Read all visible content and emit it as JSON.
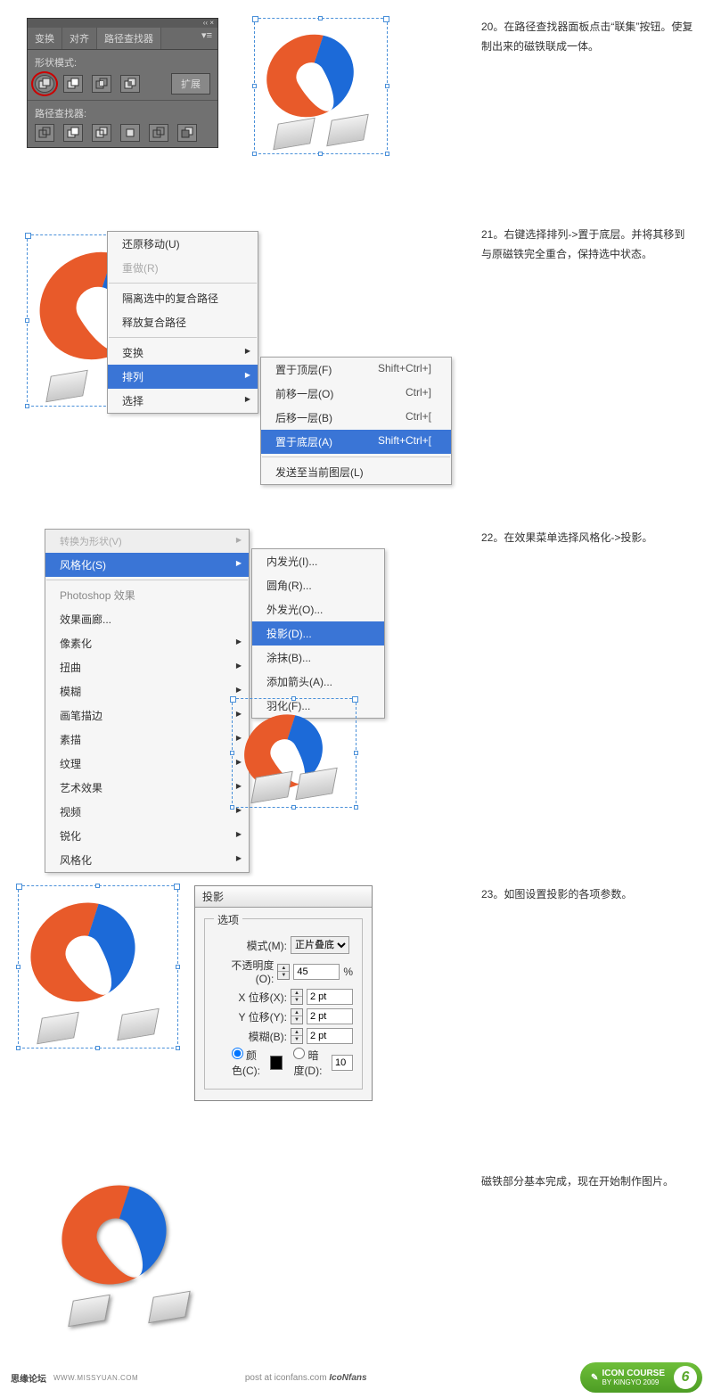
{
  "steps": {
    "s20": "20。在路径查找器面板点击“联集”按钮。使复制出来的磁铁联成一体。",
    "s21": "21。右键选择排列->置于底层。并将其移到与原磁铁完全重合，保持选中状态。",
    "s22": "22。在效果菜单选择风格化->投影。",
    "s23": "23。如图设置投影的各项参数。",
    "final": "磁铁部分基本完成，现在开始制作图片。"
  },
  "pathfinder": {
    "tabs": [
      "变换",
      "对齐",
      "路径查找器"
    ],
    "menuGlyph": "▾≡",
    "shape_label": "形状模式:",
    "path_label": "路径查找器:",
    "expand": "扩展",
    "titlebar": "‹‹ ×"
  },
  "ctxmenu1": {
    "items": [
      {
        "label": "还原移动(U)"
      },
      {
        "label": "重做(R)",
        "disabled": true
      },
      {
        "sep": true
      },
      {
        "label": "隔离选中的复合路径"
      },
      {
        "label": "释放复合路径"
      },
      {
        "sep": true
      },
      {
        "label": "变换",
        "sub": true
      },
      {
        "label": "排列",
        "sub": true,
        "hl": true
      },
      {
        "label": "选择",
        "sub": true
      }
    ],
    "submenu": [
      {
        "label": "置于顶层(F)",
        "shortcut": "Shift+Ctrl+]"
      },
      {
        "label": "前移一层(O)",
        "shortcut": "Ctrl+]"
      },
      {
        "label": "后移一层(B)",
        "shortcut": "Ctrl+["
      },
      {
        "label": "置于底层(A)",
        "shortcut": "Shift+Ctrl+[",
        "hl": true
      },
      {
        "sep": true
      },
      {
        "label": "发送至当前图层(L)"
      }
    ]
  },
  "fxmenu": {
    "top_cut": "转换为形状(V)",
    "stylize": "风格化(S)",
    "ps_header": "Photoshop 效果",
    "groups": [
      "效果画廊...",
      "像素化",
      "扭曲",
      "模糊",
      "画笔描边",
      "素描",
      "纹理",
      "艺术效果",
      "视频",
      "锐化",
      "风格化"
    ],
    "submenu": [
      "内发光(I)...",
      "圆角(R)...",
      "外发光(O)...",
      "投影(D)...",
      "涂抹(B)...",
      "添加箭头(A)...",
      "羽化(F)..."
    ],
    "hl_sub": "投影(D)..."
  },
  "dialog": {
    "title": "投影",
    "options_label": "选项",
    "mode_label": "模式(M):",
    "mode_value": "正片叠底",
    "opacity_label": "不透明度(O):",
    "opacity_value": "45",
    "percent": "%",
    "x_label": "X 位移(X):",
    "x_value": "2 pt",
    "y_label": "Y 位移(Y):",
    "y_value": "2 pt",
    "blur_label": "模糊(B):",
    "blur_value": "2 pt",
    "color_label": "颜色(C):",
    "dark_label": "暗度(D):",
    "dark_value": "10"
  },
  "footer": {
    "left": "思缘论坛",
    "left2": "WWW.MISSYUAN.COM",
    "mid": "post at iconfans.com",
    "mid2": "IcoNfans",
    "badge_title": "ICON COURSE",
    "badge_sub": "BY KINGYO 2009",
    "badge_num": "6"
  }
}
